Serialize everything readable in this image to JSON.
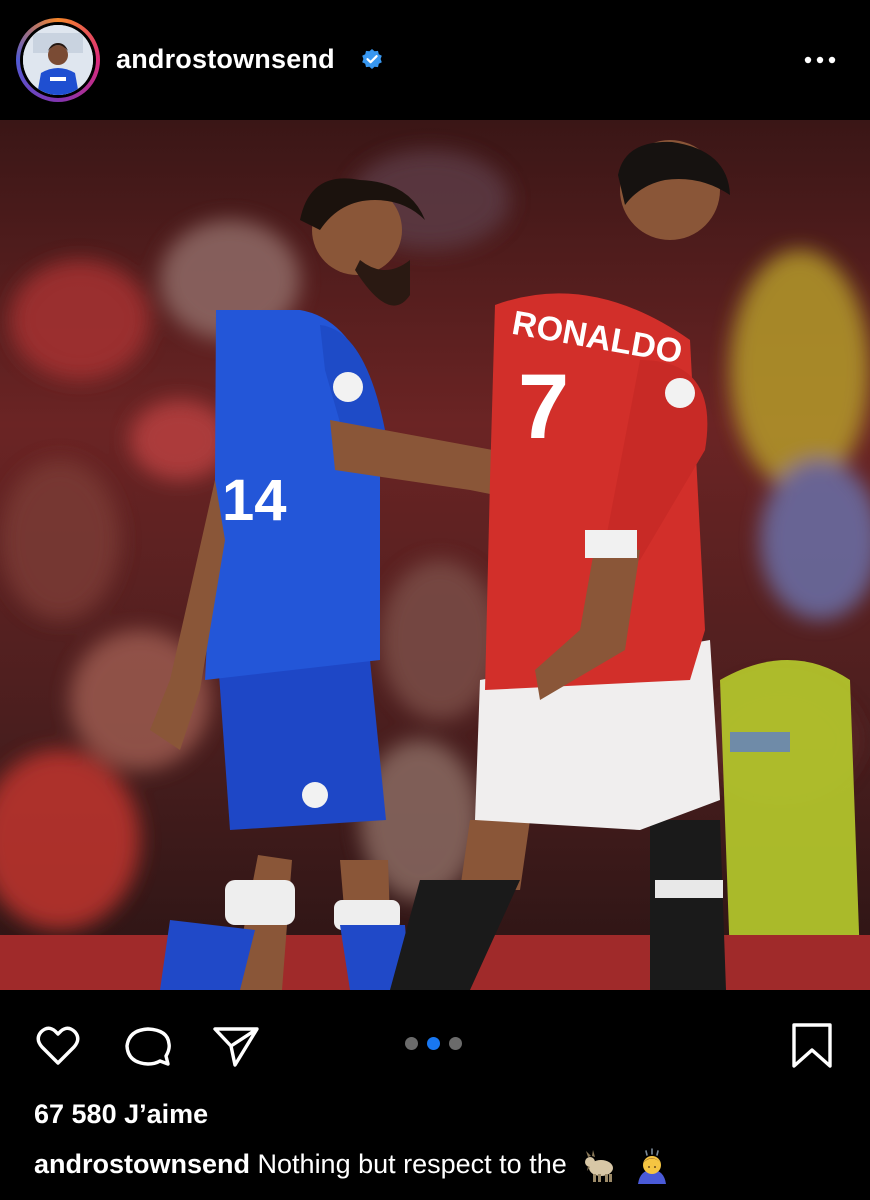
{
  "post": {
    "username": "androstownsend",
    "verified": true,
    "likes_text": "67 580 J’aime",
    "caption_username": "androstownsend",
    "caption_text": "Nothing but respect to the",
    "caption_emojis": [
      "goat-emoji",
      "bowing-person-emoji"
    ]
  },
  "photo": {
    "left_player_number": "14",
    "right_player_name": "RONALDO",
    "right_player_number": "7"
  },
  "carousel": {
    "count": 3,
    "active_index": 1
  },
  "colors": {
    "background": "#000000",
    "text": "#ffffff",
    "verified": "#3897f0",
    "carousel_active": "#1877f2",
    "carousel_inactive": "#6b6b6b",
    "everton_blue": "#1f4fd1",
    "united_red": "#d22f2a"
  },
  "icons": [
    "more-options-icon",
    "heart-icon",
    "comment-icon",
    "share-icon",
    "bookmark-icon",
    "verified-badge-icon"
  ]
}
